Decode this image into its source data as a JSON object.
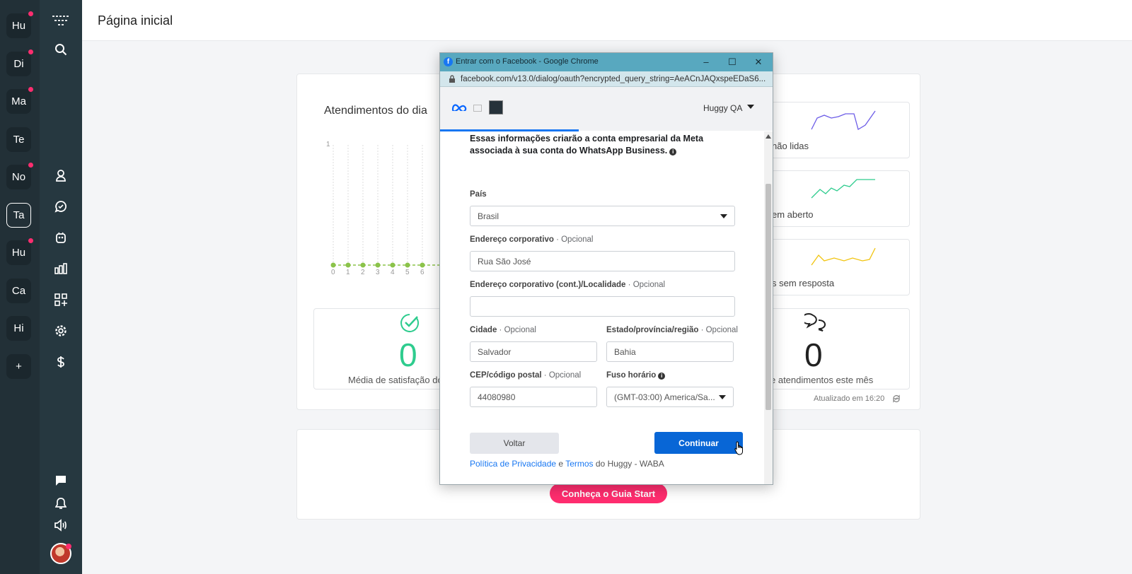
{
  "workspaces": [
    {
      "label": "Hu",
      "dot": true
    },
    {
      "label": "Di",
      "dot": true
    },
    {
      "label": "Ma",
      "dot": true
    },
    {
      "label": "Te",
      "dot": false
    },
    {
      "label": "No",
      "dot": true
    },
    {
      "label": "Ta",
      "dot": false,
      "active": true
    },
    {
      "label": "Hu",
      "dot": true
    },
    {
      "label": "Ca",
      "dot": false
    },
    {
      "label": "Hi",
      "dot": false
    },
    {
      "label": "+",
      "dot": false
    }
  ],
  "nav_icons": [
    "menu-icon",
    "search-icon",
    "contacts-icon",
    "chat-icon",
    "bot-icon",
    "reports-icon",
    "apps-icon",
    "settings-icon",
    "billing-icon",
    "messages-icon",
    "notifications-icon",
    "sound-icon"
  ],
  "header": {
    "title": "Página inicial"
  },
  "dashboard": {
    "chart_title": "Atendimentos do dia",
    "y_ticks": [
      "1",
      "0"
    ],
    "x_ticks": [
      "0",
      "1",
      "2",
      "3",
      "4",
      "5",
      "6"
    ],
    "stats": [
      {
        "value": "0",
        "label": "Média de satisfação do",
        "color": "#2ecc8e"
      },
      {
        "value": "0",
        "label": "e atendimentos este mês",
        "color": "#222222"
      }
    ],
    "mini_cards": [
      {
        "label": "não lidas",
        "color": "#6c5ce7"
      },
      {
        "label": "em aberto",
        "color": "#2ecc8e"
      },
      {
        "label": "s sem resposta",
        "color": "#f1c40f"
      }
    ],
    "updated": "Atualizado em 16:20",
    "cta_label": "Conheça o Guia Start"
  },
  "popup": {
    "window_title": "Entrar com o Facebook - Google Chrome",
    "url": "facebook.com/v13.0/dialog/oauth?encrypted_query_string=AeACnJAQxspeEDaS6...",
    "account": "Huggy QA",
    "intro": "Essas informações criarão a conta empresarial da Meta associada à sua conta do WhatsApp Business.",
    "fields": {
      "country": {
        "label": "País",
        "value": "Brasil"
      },
      "address": {
        "label": "Endereço corporativo",
        "optional": "· Opcional",
        "value": "Rua São José"
      },
      "address2": {
        "label": "Endereço corporativo (cont.)/Localidade",
        "optional": "· Opcional",
        "value": ""
      },
      "city": {
        "label": "Cidade",
        "optional": "· Opcional",
        "value": "Salvador"
      },
      "state": {
        "label": "Estado/província/região",
        "optional": "· Opcional",
        "value": "Bahia"
      },
      "zip": {
        "label": "CEP/código postal",
        "optional": "· Opcional",
        "value": "44080980"
      },
      "timezone": {
        "label": "Fuso horário",
        "value": "(GMT-03:00) America/Sa..."
      }
    },
    "back_label": "Voltar",
    "continue_label": "Continuar",
    "footer": {
      "privacy": "Política de Privacidade",
      "and": " e ",
      "terms": "Termos",
      "suffix": " do Huggy - WABA"
    }
  }
}
